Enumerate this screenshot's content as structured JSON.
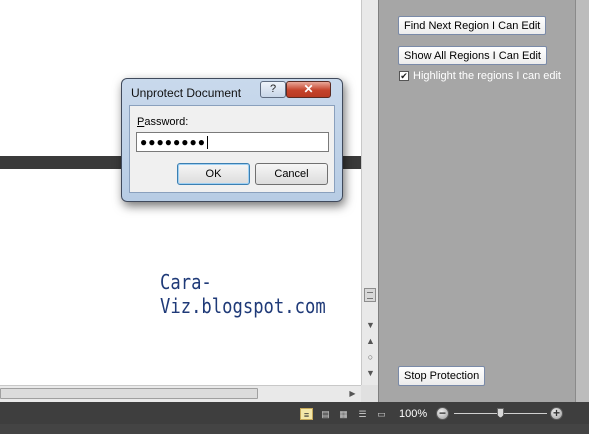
{
  "watermark": "Cara-Viz.blogspot.com",
  "pane": {
    "find_next_label": "Find Next Region I Can Edit",
    "show_all_label": "Show All Regions I Can Edit",
    "highlight_label": "Highlight the regions I can edit",
    "highlight_checked": true,
    "stop_protection_label": "Stop Protection"
  },
  "dialog": {
    "title": "Unprotect Document",
    "help_glyph": "?",
    "close_glyph": "✕",
    "password_label_accel": "P",
    "password_label_rest": "assword:",
    "password_value": "●●●●●●●●",
    "ok_label": "OK",
    "cancel_label": "Cancel"
  },
  "status": {
    "zoom_level": "100%",
    "zoom_minus": "−",
    "zoom_plus": "+",
    "zoom_fraction": 0.5
  },
  "icons": {
    "view_print_layout": "print-layout-icon",
    "view_full_screen_reading": "full-screen-reading-icon",
    "view_web_layout": "web-layout-icon",
    "view_outline": "outline-icon",
    "view_draft": "draft-icon"
  }
}
